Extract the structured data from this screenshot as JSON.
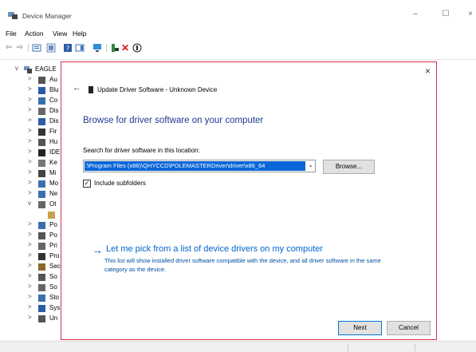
{
  "window": {
    "title": "Device Manager",
    "controls": {
      "minimize": "–",
      "maximize": "☐",
      "close": "×"
    }
  },
  "menu": [
    "File",
    "Action",
    "View",
    "Help"
  ],
  "toolbar": {
    "buttons": [
      "back-icon",
      "forward-icon",
      "properties-icon",
      "show-hidden-icon",
      "help-icon",
      "monitor-icon",
      "scan-icon",
      "update-driver-icon",
      "uninstall-icon",
      "disable-icon"
    ]
  },
  "tree": {
    "root_label": "EAGLE",
    "items": [
      "Au",
      "Blu",
      "Co",
      "Dis",
      "Dis",
      "Fir",
      "Hu",
      "IDE",
      "Ke",
      "Mi",
      "Mo",
      "Ne",
      "Ot",
      "",
      "Po",
      "Po",
      "Pri",
      "Pro",
      "Sec",
      "So",
      "So",
      "Sto",
      "Sys",
      "Un"
    ]
  },
  "dialog": {
    "close": "×",
    "back": "←",
    "header_title": "Update Driver Software - Unknown Device",
    "heading": "Browse for driver software on your computer",
    "search_label": "Search for driver software in this location:",
    "path_value": ":\\Program Files (x86)\\QHYCCD\\POLEMASTERDriver\\driver\\x86_64",
    "browse_button": "Browse...",
    "include_subfolders": "Include subfolders",
    "include_subfolders_checked": true,
    "pick_link": "Let me pick from a list of device drivers on my computer",
    "pick_arrow": "→",
    "pick_description": "This list will show installed driver software compatible with the device, and all driver software in the same category as the device.",
    "next_button": "Next",
    "cancel_button": "Cancel",
    "border_color": "#d3304a",
    "link_color": "#0066cc"
  }
}
